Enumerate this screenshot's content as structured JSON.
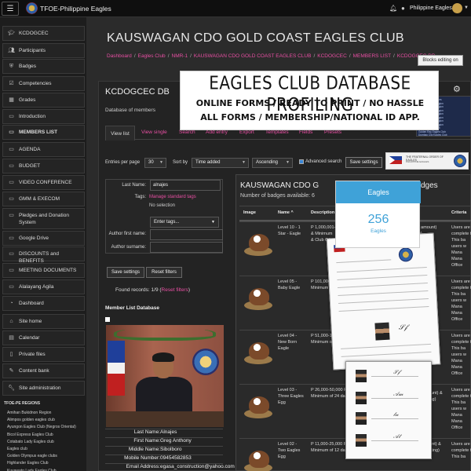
{
  "topbar": {
    "site_title": "TFOE-Philippine Eagles",
    "user_name": "Philippine Eagles"
  },
  "sidebar": {
    "items": [
      {
        "label": "KCDOGCEC",
        "icon": "graduation-cap-icon",
        "bold": false
      },
      {
        "label": "Participants",
        "icon": "users-icon",
        "bold": false
      },
      {
        "label": "Badges",
        "icon": "shield-icon",
        "bold": false
      },
      {
        "label": "Competencies",
        "icon": "checklist-icon",
        "bold": false
      },
      {
        "label": "Grades",
        "icon": "table-icon",
        "bold": false
      },
      {
        "label": "Introduction",
        "icon": "folder-icon",
        "bold": false
      },
      {
        "label": "MEMBERS LIST",
        "icon": "folder-icon",
        "bold": true
      },
      {
        "label": "AGENDA",
        "icon": "folder-icon",
        "bold": false
      },
      {
        "label": "BUDGET",
        "icon": "folder-icon",
        "bold": false
      },
      {
        "label": "VIDEO CONFERENCE",
        "icon": "folder-icon",
        "bold": false
      },
      {
        "label": "GMM & EXECOM",
        "icon": "folder-icon",
        "bold": false
      },
      {
        "label": "Pledges and Donation System",
        "icon": "folder-icon",
        "bold": false
      },
      {
        "label": "Google Drive",
        "icon": "folder-icon",
        "bold": false
      },
      {
        "label": "DISCOUNTS and BENEFITS",
        "icon": "folder-icon",
        "bold": false
      },
      {
        "label": "MEETING DOCUMENTS",
        "icon": "folder-icon",
        "bold": false
      },
      {
        "label": "Alalayang Agila",
        "icon": "folder-icon",
        "bold": false
      },
      {
        "label": "Dashboard",
        "icon": "dashboard-icon",
        "bold": false
      },
      {
        "label": "Site home",
        "icon": "home-icon",
        "bold": false
      },
      {
        "label": "Calendar",
        "icon": "calendar-icon",
        "bold": false
      },
      {
        "label": "Private files",
        "icon": "file-icon",
        "bold": false
      },
      {
        "label": "Content bank",
        "icon": "pencil-icon",
        "bold": false
      },
      {
        "label": "Site administration",
        "icon": "wrench-icon",
        "bold": false
      }
    ],
    "regions_title": "TFOE-PE REGIONS",
    "regions": [
      "Amihan Bukidnon Region",
      "Alimpos golden eagles club",
      "Ayungon Eagles Club (Negros Oriental)",
      "Bicol Express Eagles Club",
      "Cotabato Lady Eagles club",
      "Eagles club",
      "Golden Olympus eagle clubs",
      "Highlander Eagles Club",
      "Kuyawato Lady Eagles Club",
      "Libona Eagles Club"
    ]
  },
  "header": {
    "page_title": "KAUSWAGAN CDO GOLD COAST EAGLES CLUB",
    "breadcrumbs": [
      "Dashboard",
      "Eagles Club",
      "NMR-1",
      "KAUSWAGAN CDO GOLD COAST EAGLES CLUB",
      "KCDOGCEC",
      "MEMBERS LIST",
      "KCDOGCEC DB"
    ],
    "editing_button": "Blocks editing on"
  },
  "db": {
    "title": "KCDOGCEC DB",
    "subtitle": "Database of members",
    "tabs": [
      "View list",
      "View single",
      "Search",
      "Add entry",
      "Export",
      "Templates",
      "Fields",
      "Presets"
    ],
    "entries_per_page_label": "Entries per page",
    "entries_per_page": "30",
    "sort_by_label": "Sort by",
    "sort_by": "Time added",
    "sort_order": "Ascending",
    "advanced_search": "Advanced search",
    "save_settings": "Save settings",
    "filter": {
      "last_name_label": "Last Name:",
      "last_name_value": "alnajes",
      "tags_label": "Tags:",
      "manage_tags": "Manage standard tags",
      "no_selection": "No selection",
      "enter_tags": "Enter tags...",
      "author_first": "Author first name:",
      "author_surname": "Author surname:"
    },
    "reset_filters": "Reset filters",
    "found_records": "Found records: 1/9 (",
    "found_link": "Reset filters",
    "found_end": ")",
    "members_title": "Member List Database",
    "member": [
      {
        "k": "Last Name:",
        "v": "Alnajes"
      },
      {
        "k": "First Name:",
        "v": "Greg Anthony"
      },
      {
        "k": "Middle Name:",
        "v": "Sibolboro"
      },
      {
        "k": "Mobile Number:",
        "v": "09454582853"
      },
      {
        "k": "Email Address:",
        "v": "egasa_construction@yahoo.com"
      }
    ]
  },
  "seal": {
    "line1": "THE FRATERNAL ORDER OF EAGLES",
    "line2": "PHILIPPINE EAGLES"
  },
  "badges_panel": {
    "title": "KAUSWAGAN CDO G",
    "title_tail": "dges",
    "count": "Number of badges available: 6",
    "headers": [
      "Image",
      "Name ^",
      "Description",
      "Criteria"
    ],
    "rows": [
      {
        "name": [
          "Level 10 - 1",
          "Star - Eagle"
        ],
        "desc": [
          "P 1,000,001-",
          "& Minimum",
          "& Club Off"
        ],
        "crit": [
          "Users are a",
          "complete t",
          "This ba",
          "users w",
          "Mana",
          "Mana",
          "Office"
        ]
      },
      {
        "name": [
          "Level 05 -",
          "Baby Eagle"
        ],
        "desc": [
          "P 101,000-2",
          "Minimum o"
        ],
        "crit": [
          "Users are a",
          "complete t",
          "This ba",
          "users w",
          "Mana",
          "Mana",
          "Office"
        ]
      },
      {
        "name": [
          "Level 04 -",
          "New Born",
          "Eagle"
        ],
        "desc": [
          "P 51,000-100",
          "Minimum of"
        ],
        "crit": [
          "Users are a",
          "complete t",
          "This ba",
          "users w",
          "Mana",
          "Mana",
          "Office"
        ]
      },
      {
        "name": [
          "Level 03 -",
          "Three Eagles",
          "Egg"
        ],
        "desc": [
          "P 26,000-50,000 Pe",
          "Minimum of 24 da"
        ],
        "crit": [
          "Users are a",
          "complete t",
          "This ba",
          "users w",
          "Mana",
          "Mana",
          "Office"
        ]
      },
      {
        "name": [
          "Level 02 -",
          "Two Eagles",
          "Egg"
        ],
        "desc": [
          "P 11,000-25,000 Pesos Pledges and Donation (monetary amount) &",
          "Minimum of 12 days of attendance present (any activity or meeting)"
        ],
        "crit": [
          "Users are a",
          "complete t",
          "This ba"
        ]
      }
    ],
    "desc_tail_1": [
      "ary amount)",
      "ting)"
    ],
    "desc_tail_3": [
      "y amount) &",
      "meeting)"
    ]
  },
  "promo": {
    "headline": "EAGLES CLUB DATABASE PROFILING",
    "line1": "ONLINE FORMS / READY TO PRINT / NO HASSLE",
    "line2": "ALL FORMS / MEMBERSHIP/NATIONAL ID APP."
  },
  "thumb_lines": [
    "PowerPoint Facilities",
    "Prev 01 Group Region",
    "Prev 02 Group Region",
    "Prev 03 Group Region",
    "Prev 04 Group Region",
    "Prev 05 Group Region",
    "Prev 06 Group Region",
    "Prev 07 Group Region",
    "Alaska Eagles Club",
    "Golden Ray Eagles Club",
    "Dumbao City Eagles Club",
    "Holiday Ranch Eagles Club"
  ],
  "eagles_box": {
    "header": "Eagles",
    "number": "256",
    "label": "Eagles"
  },
  "colors": {
    "accent_link": "#e84fa3",
    "box_blue": "#3fa2d8"
  }
}
